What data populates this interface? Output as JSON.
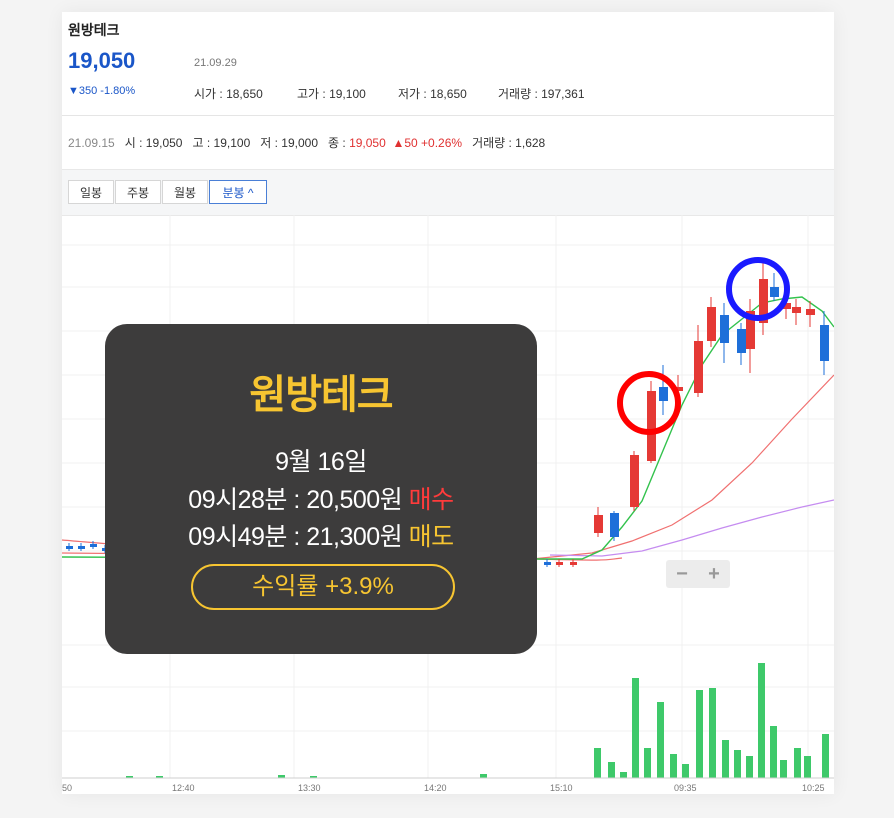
{
  "stock": {
    "name": "원방테크",
    "price": "19,050",
    "date": "21.09.29",
    "change": "▼350 -1.80%",
    "open": "시가 : 18,650",
    "high": "고가 : 19,100",
    "low": "저가 : 18,650",
    "volume": "거래량 : 197,361"
  },
  "minute_bar": {
    "date": "21.09.15",
    "open": "시 : 19,050",
    "high": "고 : 19,100",
    "low": "저 : 19,000",
    "close_label": "종 : ",
    "close_value": "19,050",
    "change": "▲50 +0.26%",
    "volume": "거래량 : 1,628"
  },
  "tabs": [
    "일봉",
    "주봉",
    "월봉",
    "분봉 ^"
  ],
  "zoom": {
    "minus": "−",
    "plus": "+"
  },
  "x_axis_labels": [
    "50",
    "12:40",
    "13:30",
    "14:20",
    "15:10",
    "09:35",
    "10:25"
  ],
  "overlay": {
    "title": "원방테크",
    "date": "9월 16일",
    "buy_line": "09시28분 : 20,500원",
    "buy_tag": "매수",
    "sell_line": "09시49분 : 21,300원",
    "sell_tag": "매도",
    "profit": "수익률 +3.9%"
  },
  "colors": {
    "up": "#e53935",
    "down": "#1e6fd9",
    "ma5": "#33c24d",
    "ma20": "#f07070",
    "ma60": "#c58cf0",
    "volume": "#3ec96a",
    "highlight_buy": "#ff0000",
    "highlight_sell": "#1a1aff"
  }
}
